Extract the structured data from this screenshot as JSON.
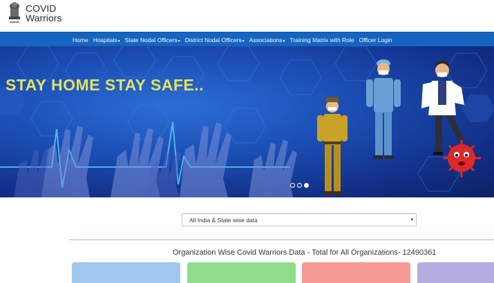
{
  "header": {
    "title_line1": "COVID",
    "title_line2": "Warriors"
  },
  "nav": {
    "items": [
      {
        "label": "Home",
        "dropdown": false
      },
      {
        "label": "Hospitals",
        "dropdown": true
      },
      {
        "label": "State Nodal Officers",
        "dropdown": true
      },
      {
        "label": "District Nodal Officers",
        "dropdown": true
      },
      {
        "label": "Associations",
        "dropdown": true
      },
      {
        "label": "Training Matrix with Role",
        "dropdown": false
      },
      {
        "label": "Officer Login",
        "dropdown": false
      }
    ],
    "caret": "▾"
  },
  "banner": {
    "headline": "STAY HOME STAY SAFE..",
    "slide_count": 3,
    "active_slide": 3
  },
  "filter": {
    "selected": "All India & State wise data",
    "arrow": "▾"
  },
  "org": {
    "title": "Organization Wise Covid Warriors Data - Total for All Organizations- 12490361"
  },
  "colors": {
    "nav_bg": "#1565c0",
    "headline": "#e3e25a",
    "card_blue": "#9fc8ec",
    "card_green": "#8fdc8a",
    "card_red": "#f59a95",
    "card_purple": "#b3aee0"
  }
}
